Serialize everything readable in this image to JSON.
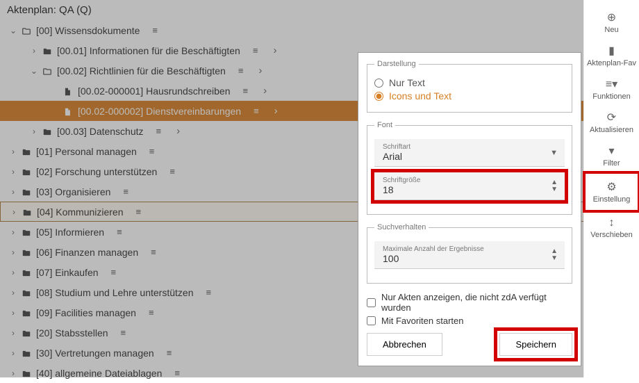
{
  "title": "Aktenplan: QA (Q)",
  "tree": [
    {
      "depth": 0,
      "expand": "down",
      "kind": "outline",
      "label": "[00] Wissensdokumente",
      "menu": true,
      "arrow": false
    },
    {
      "depth": 1,
      "expand": "right",
      "kind": "solid",
      "label": "[00.01] Informationen für die Beschäftigten",
      "menu": true,
      "arrow": true
    },
    {
      "depth": 1,
      "expand": "down",
      "kind": "outline",
      "label": "[00.02] Richtlinien für die Beschäftigten",
      "menu": true,
      "arrow": true
    },
    {
      "depth": 2,
      "expand": "none",
      "kind": "file",
      "label": "[00.02-000001] Hausrundschreiben",
      "menu": true,
      "arrow": true
    },
    {
      "depth": 2,
      "expand": "none",
      "kind": "file",
      "label": "[00.02-000002] Dienstvereinbarungen",
      "menu": true,
      "arrow": true,
      "sel": true
    },
    {
      "depth": 1,
      "expand": "right",
      "kind": "solid",
      "label": "[00.03] Datenschutz",
      "menu": true,
      "arrow": true
    },
    {
      "depth": 0,
      "expand": "right",
      "kind": "solid",
      "label": "[01] Personal managen",
      "menu": true,
      "arrow": false
    },
    {
      "depth": 0,
      "expand": "right",
      "kind": "solid",
      "label": "[02] Forschung unterstützen",
      "menu": true,
      "arrow": false
    },
    {
      "depth": 0,
      "expand": "right",
      "kind": "solid",
      "label": "[03] Organisieren",
      "menu": true,
      "arrow": false
    },
    {
      "depth": 0,
      "expand": "right",
      "kind": "solid",
      "label": "[04] Kommunizieren",
      "menu": true,
      "arrow": false,
      "selLight": true
    },
    {
      "depth": 0,
      "expand": "right",
      "kind": "solid",
      "label": "[05] Informieren",
      "menu": true,
      "arrow": false
    },
    {
      "depth": 0,
      "expand": "right",
      "kind": "solid",
      "label": "[06] Finanzen managen",
      "menu": true,
      "arrow": false
    },
    {
      "depth": 0,
      "expand": "right",
      "kind": "solid",
      "label": "[07] Einkaufen",
      "menu": true,
      "arrow": false
    },
    {
      "depth": 0,
      "expand": "right",
      "kind": "solid",
      "label": "[08] Studium und Lehre unterstützen",
      "menu": true,
      "arrow": false
    },
    {
      "depth": 0,
      "expand": "right",
      "kind": "solid",
      "label": "[09] Facilities managen",
      "menu": true,
      "arrow": false
    },
    {
      "depth": 0,
      "expand": "right",
      "kind": "solid",
      "label": "[20] Stabsstellen",
      "menu": true,
      "arrow": false
    },
    {
      "depth": 0,
      "expand": "right",
      "kind": "solid",
      "label": "[30] Vertretungen managen",
      "menu": true,
      "arrow": false
    },
    {
      "depth": 0,
      "expand": "right",
      "kind": "solid",
      "label": "[40] allgemeine Dateiablagen",
      "menu": true,
      "arrow": false
    }
  ],
  "sidebar": [
    {
      "icon": "⊕",
      "label": "Neu",
      "name": "sidebar-new"
    },
    {
      "icon": "▮",
      "label": "Aktenplan-Fav",
      "name": "sidebar-fav"
    },
    {
      "icon": "≡▾",
      "label": "Funktionen",
      "name": "sidebar-functions"
    },
    {
      "icon": "⟳",
      "label": "Aktualisieren",
      "name": "sidebar-refresh"
    },
    {
      "icon": "▾",
      "label": "Filter",
      "name": "sidebar-filter"
    },
    {
      "icon": "⚙",
      "label": "Einstellung",
      "name": "sidebar-settings",
      "hl": true
    },
    {
      "icon": "↕",
      "label": "Verschieben",
      "name": "sidebar-move"
    }
  ],
  "dialog": {
    "darstellung": {
      "legend": "Darstellung",
      "opt1": "Nur Text",
      "opt2": "Icons und Text",
      "selected": "opt2"
    },
    "font": {
      "legend": "Font",
      "schriftartLabel": "Schriftart",
      "schriftartValue": "Arial",
      "sizeLabel": "Schriftgröße",
      "sizeValue": "18"
    },
    "search": {
      "legend": "Suchverhalten",
      "maxLabel": "Maximale Anzahl der Ergebnisse",
      "maxValue": "100"
    },
    "chk1": "Nur Akten anzeigen, die nicht zdA verfügt wurden",
    "chk2": "Mit Favoriten starten",
    "cancel": "Abbrechen",
    "save": "Speichern"
  }
}
